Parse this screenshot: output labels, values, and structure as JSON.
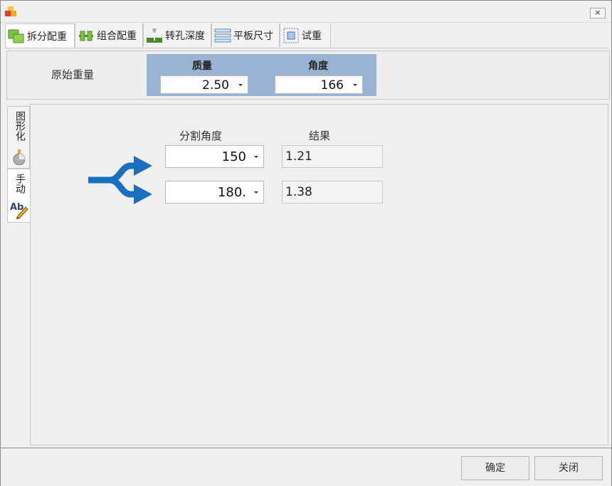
{
  "window": {
    "close_glyph": "×"
  },
  "tabs": [
    {
      "label": "拆分配重",
      "icon": "split-weights-icon"
    },
    {
      "label": "组合配重",
      "icon": "combine-weights-icon"
    },
    {
      "label": "转孔深度",
      "icon": "drill-depth-icon"
    },
    {
      "label": "平板尺寸",
      "icon": "plate-size-icon"
    },
    {
      "label": "试重",
      "icon": "trial-weight-icon"
    }
  ],
  "original_weight": {
    "label": "原始重量",
    "mass_header": "质量",
    "mass_value": "2.50",
    "angle_header": "角度",
    "angle_value": "166"
  },
  "side_tabs": [
    {
      "label": "图形化",
      "icon": "pie-chart-icon"
    },
    {
      "label": "手动",
      "icon": "edit-text-icon",
      "icon_text": "Ab"
    }
  ],
  "split": {
    "angle_header": "分割角度",
    "result_header": "结果",
    "rows": [
      {
        "angle": "150",
        "result": "1.21"
      },
      {
        "angle": "180.",
        "result": "1.38"
      }
    ]
  },
  "buttons": {
    "ok": "确定",
    "close": "关闭"
  },
  "colors": {
    "accent_blue": "#1a6fbf",
    "group_header_bg": "#9ab3d2"
  }
}
